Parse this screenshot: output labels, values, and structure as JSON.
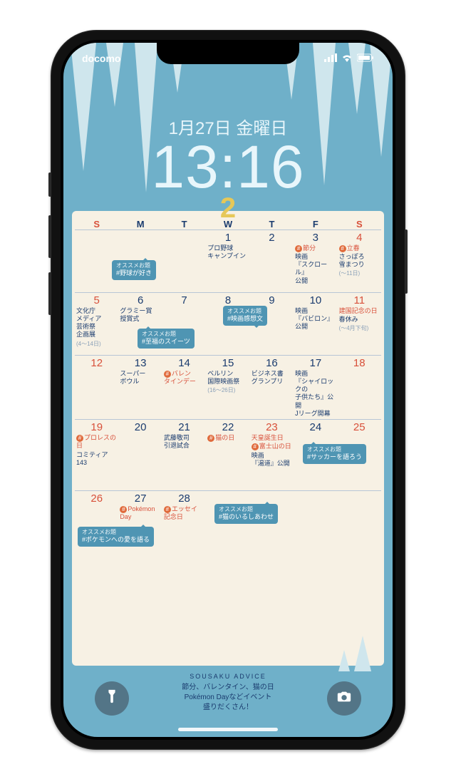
{
  "status": {
    "carrier": "docomo"
  },
  "lock": {
    "date": "1月27日 金曜日",
    "time": "13:16"
  },
  "month": "2",
  "dow": [
    "S",
    "M",
    "T",
    "W",
    "T",
    "F",
    "S"
  ],
  "bubbles": {
    "b1": {
      "label": "オススメお題",
      "text": "#野球が好き"
    },
    "b2": {
      "label": "オススメお題",
      "text": "#至福のスイーツ"
    },
    "b3": {
      "label": "オススメお題",
      "text": "#映画感想文"
    },
    "b4": {
      "label": "オススメお題",
      "text": "#サッカーを語ろう"
    },
    "b5": {
      "label": "オススメお題",
      "text": "#猫のいるしあわせ"
    },
    "b6": {
      "label": "オススメお題",
      "text": "#ポケモンへの愛を語る"
    }
  },
  "days": {
    "d1": "1",
    "d2": "2",
    "d3": "3",
    "d4": "4",
    "d5": "5",
    "d6": "6",
    "d7": "7",
    "d8": "8",
    "d9": "9",
    "d10": "10",
    "d11": "11",
    "d12": "12",
    "d13": "13",
    "d14": "14",
    "d15": "15",
    "d16": "16",
    "d17": "17",
    "d18": "18",
    "d19": "19",
    "d20": "20",
    "d21": "21",
    "d22": "22",
    "d23": "23",
    "d24": "24",
    "d25": "25",
    "d26": "26",
    "d27": "27",
    "d28": "28"
  },
  "ev": {
    "e1": "プロ野球\nキャンプイン",
    "e3a": "節分",
    "e3b": "映画\n『スクロール』\n公開",
    "e4a": "立春",
    "e4b": "さっぽろ\n雪まつり",
    "e4c": "(〜11日)",
    "e5a": "文化庁\nメディア\n芸術祭\n企画展",
    "e5c": "(4〜14日)",
    "e6": "グラミー賞\n授賞式",
    "e10": "映画\n『バビロン』\n公開",
    "e11a": "建国記念の日",
    "e11b": "春休み",
    "e11c": "(〜4月下旬)",
    "e13": "スーパー\nボウル",
    "e14": "バレン\nタインデー",
    "e15a": "ベルリン\n国際映画祭",
    "e15c": "(16〜26日)",
    "e16": "ビジネス書\nグランプリ",
    "e17": "映画\n『シャイロックの\n子供たち』公開\nJリーグ開幕",
    "e19a": "プロレスの日",
    "e19b": "コミティア143",
    "e21": "武藤敬司\n引退試合",
    "e22": "猫の日",
    "e23a": "天皇誕生日",
    "e23b": "富士山の日",
    "e23c": "映画\n『湯道』公開",
    "e27": "Pokémon\nDay",
    "e28": "エッセイ\n記念日"
  },
  "advice": {
    "title": "SOUSAKU ADVICE",
    "text": "節分、バレンタイン、猫の日\nPokémon Dayなどイベント\n盛りだくさん！"
  }
}
